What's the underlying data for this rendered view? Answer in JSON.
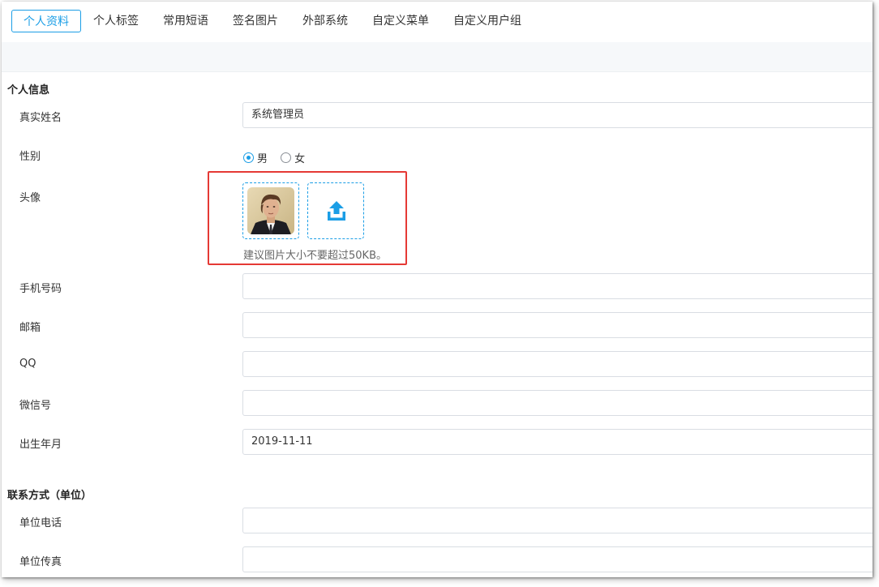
{
  "tabs": [
    {
      "label": "个人资料",
      "active": true
    },
    {
      "label": "个人标签"
    },
    {
      "label": "常用短语"
    },
    {
      "label": "签名图片"
    },
    {
      "label": "外部系统"
    },
    {
      "label": "自定义菜单"
    },
    {
      "label": "自定义用户组"
    }
  ],
  "sections": {
    "personal": {
      "title": "个人信息",
      "real_name": {
        "label": "真实姓名",
        "value": "系统管理员"
      },
      "gender": {
        "label": "性别",
        "options": [
          "男",
          "女"
        ],
        "selected": "男"
      },
      "avatar": {
        "label": "头像",
        "hint": "建议图片大小不要超过50KB。"
      },
      "phone": {
        "label": "手机号码",
        "value": ""
      },
      "email": {
        "label": "邮箱",
        "value": ""
      },
      "qq": {
        "label": "QQ",
        "value": ""
      },
      "wechat": {
        "label": "微信号",
        "value": ""
      },
      "birth": {
        "label": "出生年月",
        "value": "2019-11-11"
      }
    },
    "contact": {
      "title": "联系方式（单位）",
      "work_phone": {
        "label": "单位电话",
        "value": ""
      },
      "work_fax": {
        "label": "单位传真",
        "value": ""
      }
    }
  },
  "icons": {
    "avatar": "person-photo",
    "upload": "upload-icon"
  },
  "colors": {
    "accent": "#1b9ee6",
    "highlight": "#e53935"
  }
}
